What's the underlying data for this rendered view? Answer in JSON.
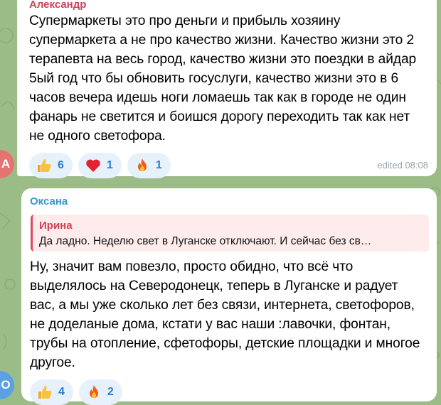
{
  "messages": [
    {
      "sender": "Александр",
      "text": "Супермаркеты это про деньги и прибыль хозяину супермаркета а не про качество жизни. Качество жизни это 2 терапевта на весь город, качество жизни это поездки в айдар 5ый год что бы обновить госуслуги, качество жизни это в 6 часов вечера идешь ноги ломаешь так как в городе не один фанарь не светится и боишся дорогу переходить так как нет не одного светофора.",
      "reactions": [
        {
          "emoji": "thumbs-up-icon",
          "count": "6"
        },
        {
          "emoji": "heart-icon",
          "count": "1"
        },
        {
          "emoji": "fire-icon",
          "count": "1"
        }
      ],
      "time": "edited 08:08",
      "avatar_letter": "А"
    },
    {
      "sender": "Оксана",
      "reply": {
        "author": "Ирина",
        "text": "Да ладно. Неделю свет в Луганске отключают. И сейчас без св…"
      },
      "text": "Ну, значит вам повезло, просто обидно, что всё что выделялось на Северодонецк, теперь в Луганске и радует вас, а мы уже сколько лет без связи, интернета, светофоров, не доделаные дома, кстати у вас наши :лавочки, фонтан, трубы на отопление, сфетофоры, детские площадки и многое другое.",
      "reactions": [
        {
          "emoji": "thumbs-up-icon",
          "count": "4"
        },
        {
          "emoji": "fire-icon",
          "count": "2"
        }
      ],
      "avatar_letter": "О"
    }
  ],
  "colors": {
    "background": "#9bbc86",
    "sender1": "#c8455b",
    "sender2": "#3a96c8",
    "reaction_bg": "#e6f1fc",
    "reaction_count": "#2c7fd0",
    "reply_bar": "#e0465c"
  }
}
